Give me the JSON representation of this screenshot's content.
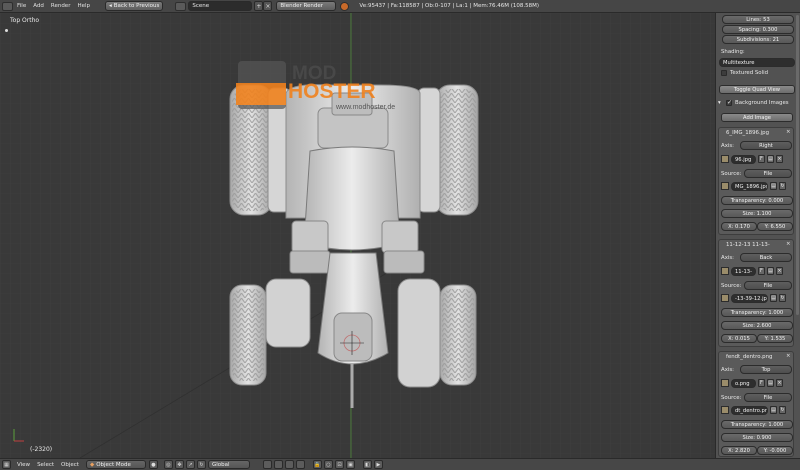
{
  "topbar": {
    "menus": [
      "File",
      "Add",
      "Render",
      "Help"
    ],
    "back_button": "Back to Previous",
    "scene": "Scene",
    "render_engine": "Blender Render",
    "stats": "Ve:95437 | Fa:118587 | Ob:0-107 | La:1 | Mem:76.46M (108.58M)"
  },
  "viewport": {
    "view_name": "Top Ortho",
    "frame": "(-2320)",
    "watermark_top": "MOD",
    "watermark_main": "HOSTER",
    "watermark_url": "www.modhoster.de"
  },
  "panel": {
    "lines": "Lines: 53",
    "spacing": "Spacing: 0.300",
    "subdivisions": "Subdivisions: 21",
    "shading_label": "Shading:",
    "shading_value": "Multitexture",
    "textured_solid": "Textured Solid",
    "toggle_quad": "Toggle Quad View",
    "bg_images": "Background Images",
    "add_image": "Add Image",
    "images": [
      {
        "name": "6_IMG_1896.jpg",
        "axis": "Right",
        "file": "96.jpg",
        "source": "File",
        "path": "MG_1896.jpg",
        "transparency": "Transparency: 0.000",
        "size": "Size: 1.100",
        "x": "X: 0.170",
        "y": "Y: 6.550"
      },
      {
        "name": "11-12-13 11-13-",
        "axis": "Back",
        "file": "11-13-",
        "source": "File",
        "path": "-13-39-12.jpg",
        "transparency": "Transparency: 1.000",
        "size": "Size: 2.600",
        "x": "X: 0.015",
        "y": "Y: 1.535"
      },
      {
        "name": "fendt_dentro.png",
        "axis": "Top",
        "file": "o.png",
        "source": "File",
        "path": "dt_dentro.png",
        "transparency": "Transparency: 1.000",
        "size": "Size: 0.900",
        "x": "X: 2.820",
        "y": "Y: -0.000"
      }
    ],
    "axis_label": "Axis:",
    "source_label": "Source:",
    "f_label": "F"
  },
  "bottombar": {
    "menus": [
      "View",
      "Select",
      "Object"
    ],
    "mode": "Object Mode",
    "orientation": "Global"
  },
  "colors": {
    "viewport_bg": "#393939",
    "grid": "#444444",
    "x_axis": "#8a3a3a",
    "y_axis": "#4f8a3a",
    "model": "#cfcfcf",
    "watermark_orange": "#f0821e"
  }
}
